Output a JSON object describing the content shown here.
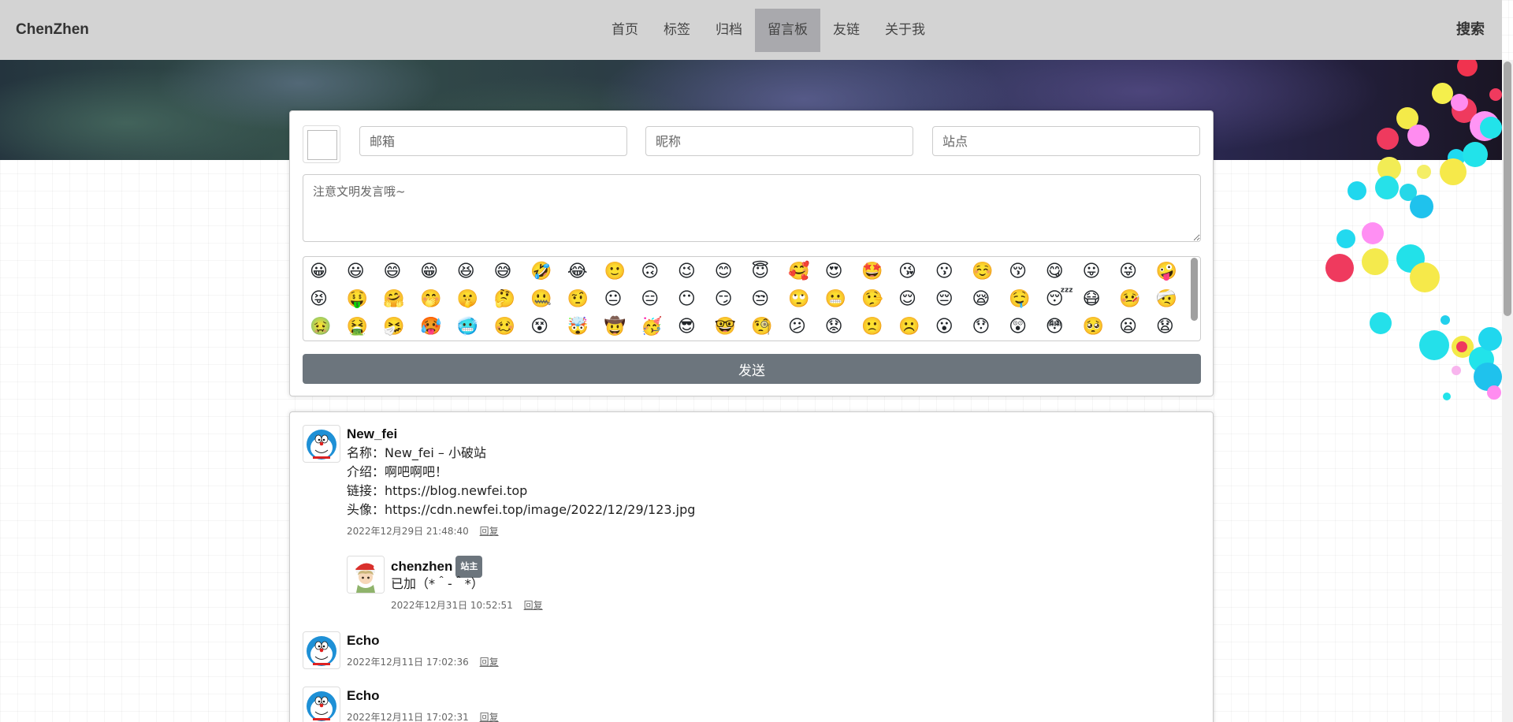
{
  "nav": {
    "brand": "ChenZhen",
    "links": [
      "首页",
      "标签",
      "归档",
      "留言板",
      "友链",
      "关于我"
    ],
    "active_index": 3,
    "search": "搜索"
  },
  "form": {
    "email_placeholder": "邮箱",
    "nickname_placeholder": "昵称",
    "site_placeholder": "站点",
    "content_placeholder": "注意文明发言哦~",
    "send_label": "发送"
  },
  "emojis": [
    "😀",
    "😃",
    "😄",
    "😁",
    "😆",
    "😅",
    "🤣",
    "😂",
    "🙂",
    "🙃",
    "😉",
    "😊",
    "😇",
    "🥰",
    "😍",
    "🤩",
    "😘",
    "😗",
    "☺️",
    "😚",
    "😋",
    "😛",
    "😜",
    "🤪",
    "😝",
    "🤑",
    "🤗",
    "🤭",
    "🤫",
    "🤔",
    "🤐",
    "🤨",
    "😐",
    "😑",
    "😶",
    "😏",
    "😒",
    "🙄",
    "😬",
    "🤥",
    "😌",
    "😔",
    "😪",
    "🤤",
    "😴",
    "😷",
    "🤒",
    "🤕",
    "🤢",
    "🤮",
    "🤧",
    "🥵",
    "🥶",
    "🥴",
    "😵",
    "🤯",
    "🤠",
    "🥳",
    "😎",
    "🤓",
    "🧐",
    "😕",
    "😟",
    "🙁",
    "☹️",
    "😮",
    "😯",
    "😲",
    "😳",
    "🥺",
    "😦",
    "😧"
  ],
  "comments": [
    {
      "name": "New_fei",
      "lines": [
        "名称：New_fei – 小破站",
        "介绍：啊吧啊吧！",
        "链接：https://blog.newfei.top",
        "头像：https://cdn.newfei.top/image/2022/12/29/123.jpg"
      ],
      "time": "2022年12月29日 21:48:40",
      "reply": "回复",
      "reply_item": {
        "name": "chenzhen",
        "badge": "站主",
        "text": "已加（*＾-＾*）",
        "time": "2022年12月31日 10:52:51",
        "reply": "回复"
      }
    },
    {
      "name": "Echo",
      "time": "2022年12月11日 17:02:36",
      "reply": "回复"
    },
    {
      "name": "Echo",
      "time": "2022年12月11日 17:02:31",
      "reply": "回复"
    }
  ],
  "colors": {
    "navbar": "#d3d3d3",
    "nav_active": "#a9a9ad",
    "send_button": "#6c757d",
    "badge": "#6c757d"
  }
}
